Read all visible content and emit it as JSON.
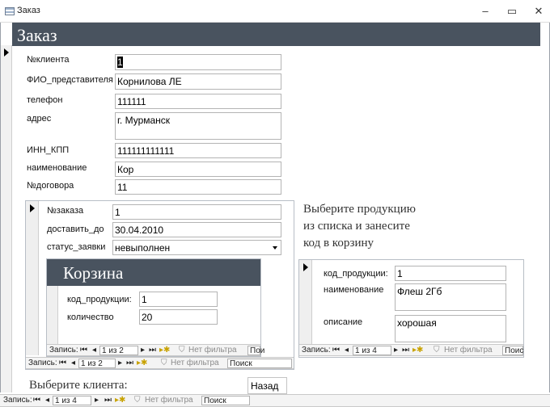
{
  "window": {
    "title": "Заказ",
    "controls": {
      "minimize": "‒",
      "maximize": "▭",
      "close": "✕"
    }
  },
  "form": {
    "header_title": "Заказ",
    "fields": [
      {
        "label": "№клиента",
        "value": "1"
      },
      {
        "label": "ФИО_представителя",
        "value": "Корнилова ЛЕ"
      },
      {
        "label": "телефон",
        "value": "111111"
      },
      {
        "label": "адрес",
        "value": "г. Мурманск"
      },
      {
        "label": "ИНН_КПП",
        "value": "111111111111"
      },
      {
        "label": "наименование",
        "value": "Кор"
      },
      {
        "label": "№договора",
        "value": "11"
      }
    ]
  },
  "order_subform": {
    "fields": [
      {
        "label": "№заказа",
        "value": "1"
      },
      {
        "label": "доставить_до",
        "value": "30.04.2010"
      },
      {
        "label": "статус_заявки",
        "value": "невыполнен"
      }
    ],
    "cart": {
      "title": "Корзина",
      "fields": [
        {
          "label": "код_продукции:",
          "value": "1"
        },
        {
          "label": "количество",
          "value": "20"
        }
      ],
      "nav": {
        "record_label": "Запись:",
        "position": "1 из 2",
        "filter": "Нет фильтра",
        "search": "Пои"
      }
    },
    "nav": {
      "record_label": "Запись:",
      "position": "1 из 2",
      "filter": "Нет фильтра",
      "search": "Поиск"
    }
  },
  "instruction": {
    "line1": "Выберите продукцию",
    "line2": "из списка и занесите",
    "line3": "код в корзину"
  },
  "product_subform": {
    "fields": [
      {
        "label": "код_продукции:",
        "value": "1"
      },
      {
        "label": "наименование",
        "value": "Флеш 2Гб"
      },
      {
        "label": "описание",
        "value": "хорошая"
      }
    ],
    "nav": {
      "record_label": "Запись:",
      "position": "1 из 4",
      "filter": "Нет фильтра",
      "search": "Поис"
    }
  },
  "client_prompt": "Выберите клиента:",
  "back_button": "Назад",
  "main_nav": {
    "record_label": "Запись:",
    "position": "1 из 4",
    "filter": "Нет фильтра",
    "search": "Поиск"
  },
  "nav_glyphs": {
    "first": "⏮",
    "prev": "◂",
    "next": "▸",
    "last": "⏭",
    "new": "▸✱",
    "filter_icon": "⛉"
  }
}
